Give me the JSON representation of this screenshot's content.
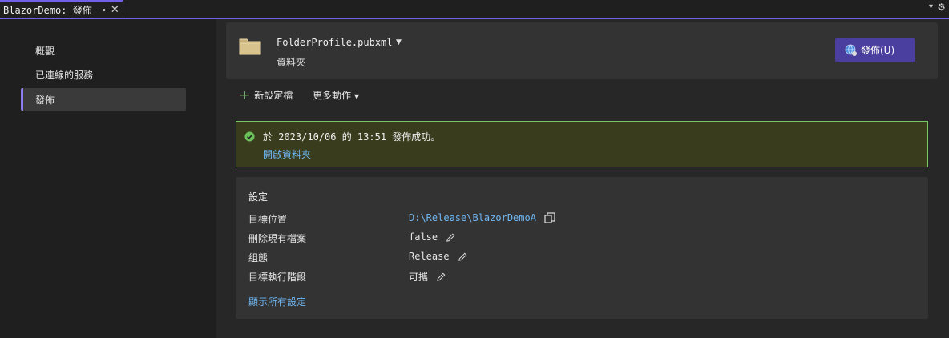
{
  "tab": {
    "title": "BlazorDemo: 發佈",
    "pin_glyph": "⊸",
    "close_glyph": "✕",
    "overflow_glyph": "▾",
    "gear_glyph": "⚙"
  },
  "nav": {
    "items": [
      {
        "label": "概觀",
        "selected": false
      },
      {
        "label": "已連線的服務",
        "selected": false
      },
      {
        "label": "發佈",
        "selected": true
      }
    ]
  },
  "profile": {
    "name": "FolderProfile.pubxml",
    "caret": "▼",
    "type": "資料夾",
    "publish_label": "發佈(U)"
  },
  "actions": {
    "new_profile_label": "新設定檔",
    "new_profile_icon": "plus-icon",
    "more_actions_label": "更多動作",
    "caret": "▼"
  },
  "status": {
    "message": "於 2023/10/06 的 13:51 發佈成功。",
    "link_label": "開啟資料夾",
    "accent": "#7ac56a",
    "background": "#393d1e"
  },
  "settings": {
    "title": "設定",
    "rows": [
      {
        "label": "目標位置",
        "value": "D:\\Release\\BlazorDemoA",
        "action": "copy"
      },
      {
        "label": "刪除現有檔案",
        "value": "false",
        "action": "edit"
      },
      {
        "label": "組態",
        "value": "Release",
        "action": "edit"
      },
      {
        "label": "目標執行階段",
        "value": "可攜",
        "action": "edit"
      }
    ],
    "show_all_label": "顯示所有設定"
  },
  "colors": {
    "accent": "#7160e8",
    "link": "#6fb6f2",
    "publish_button": "#4a3e9e"
  }
}
